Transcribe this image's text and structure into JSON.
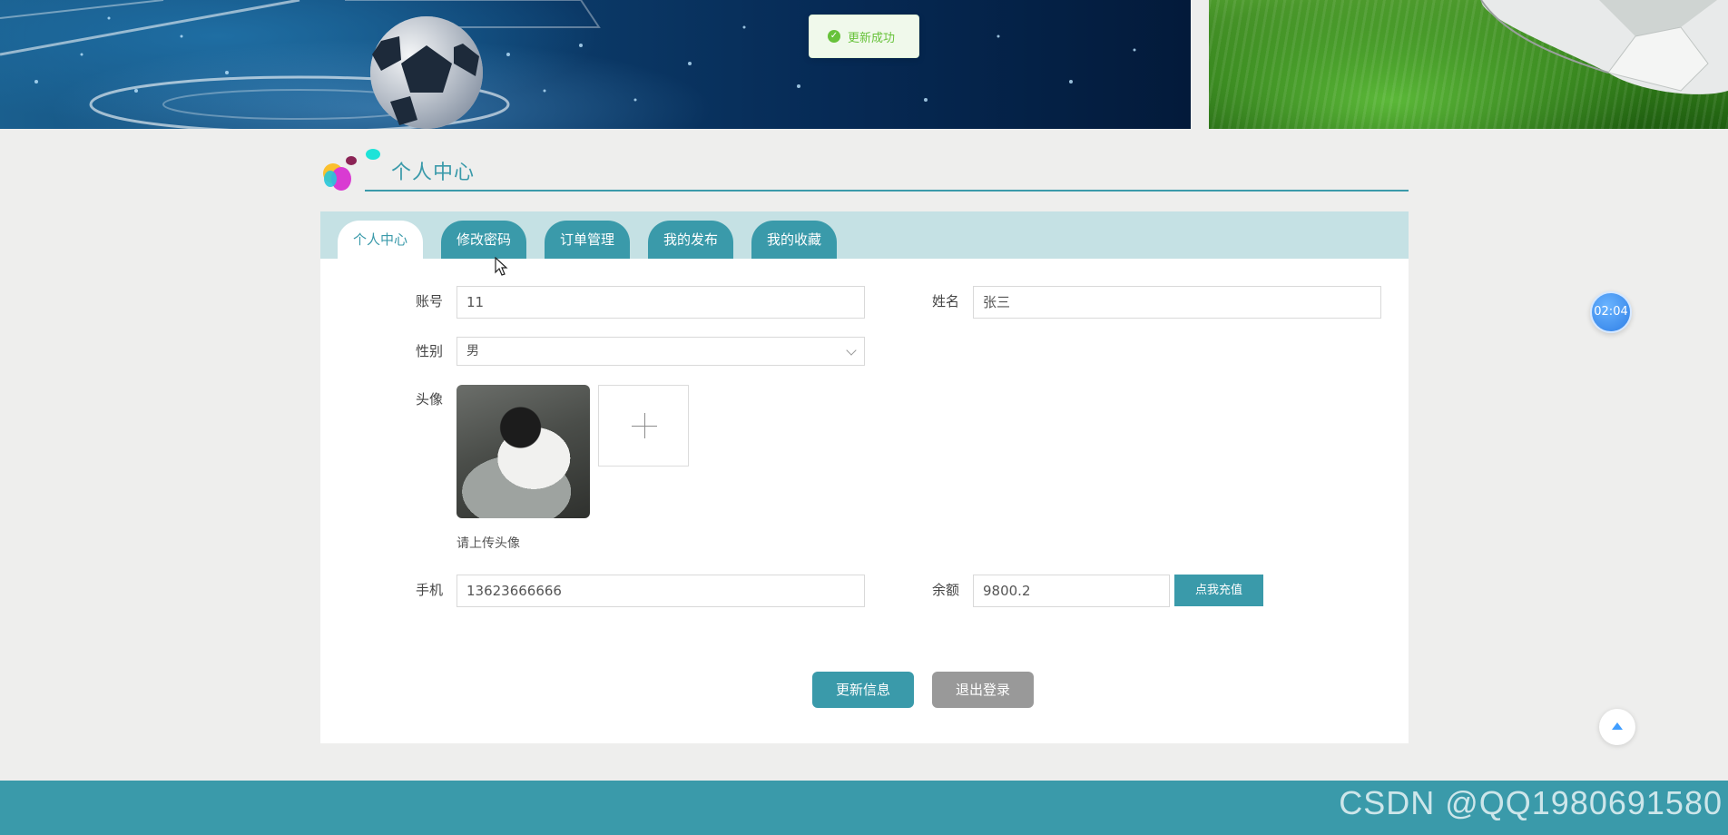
{
  "toast": {
    "text": "更新成功"
  },
  "section": {
    "title": "个人中心"
  },
  "tabs": [
    {
      "label": "个人中心",
      "active": true
    },
    {
      "label": "修改密码",
      "active": false
    },
    {
      "label": "订单管理",
      "active": false
    },
    {
      "label": "我的发布",
      "active": false
    },
    {
      "label": "我的收藏",
      "active": false
    }
  ],
  "form": {
    "account_label": "账号",
    "account_value": "11",
    "name_label": "姓名",
    "name_value": "张三",
    "gender_label": "性别",
    "gender_value": "男",
    "avatar_label": "头像",
    "avatar_hint": "请上传头像",
    "phone_label": "手机",
    "phone_value": "13623666666",
    "balance_label": "余额",
    "balance_value": "9800.2",
    "recharge_label": "点我充值"
  },
  "actions": {
    "update_label": "更新信息",
    "logout_label": "退出登录"
  },
  "timer": {
    "text": "02:04"
  },
  "footer": {
    "watermark": "CSDN @QQ1980691580"
  },
  "colors": {
    "accent": "#3a9aaa",
    "tab_bar": "#c5e1e4",
    "toast_green": "#67c23a",
    "logout_gray": "#999999",
    "page_bg": "#eeeeed"
  },
  "icons": [
    "success-check-icon",
    "plus-icon",
    "chevron-down-icon",
    "back-to-top-arrow-icon",
    "mouse-cursor-icon"
  ]
}
